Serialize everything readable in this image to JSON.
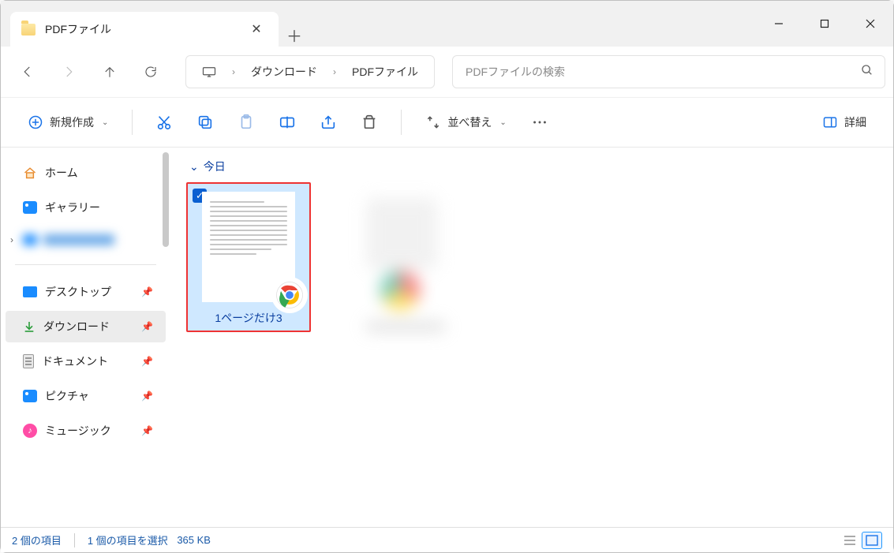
{
  "window": {
    "tab_title": "PDFファイル"
  },
  "breadcrumb": {
    "root_icon": "this-pc",
    "items": [
      "ダウンロード",
      "PDFファイル"
    ]
  },
  "search": {
    "placeholder": "PDFファイルの検索"
  },
  "toolbar": {
    "new_label": "新規作成",
    "sort_label": "並べ替え",
    "details_label": "詳細"
  },
  "sidebar": {
    "home": "ホーム",
    "gallery": "ギャラリー",
    "hidden": "　　　　",
    "desktop": "デスクトップ",
    "download": "ダウンロード",
    "documents": "ドキュメント",
    "pictures": "ピクチャ",
    "music": "ミュージック"
  },
  "content": {
    "group_today": "今日",
    "file1_name": "1ページだけ3"
  },
  "status": {
    "count": "2 個の項目",
    "selection": "1 個の項目を選択",
    "size": "365 KB"
  }
}
